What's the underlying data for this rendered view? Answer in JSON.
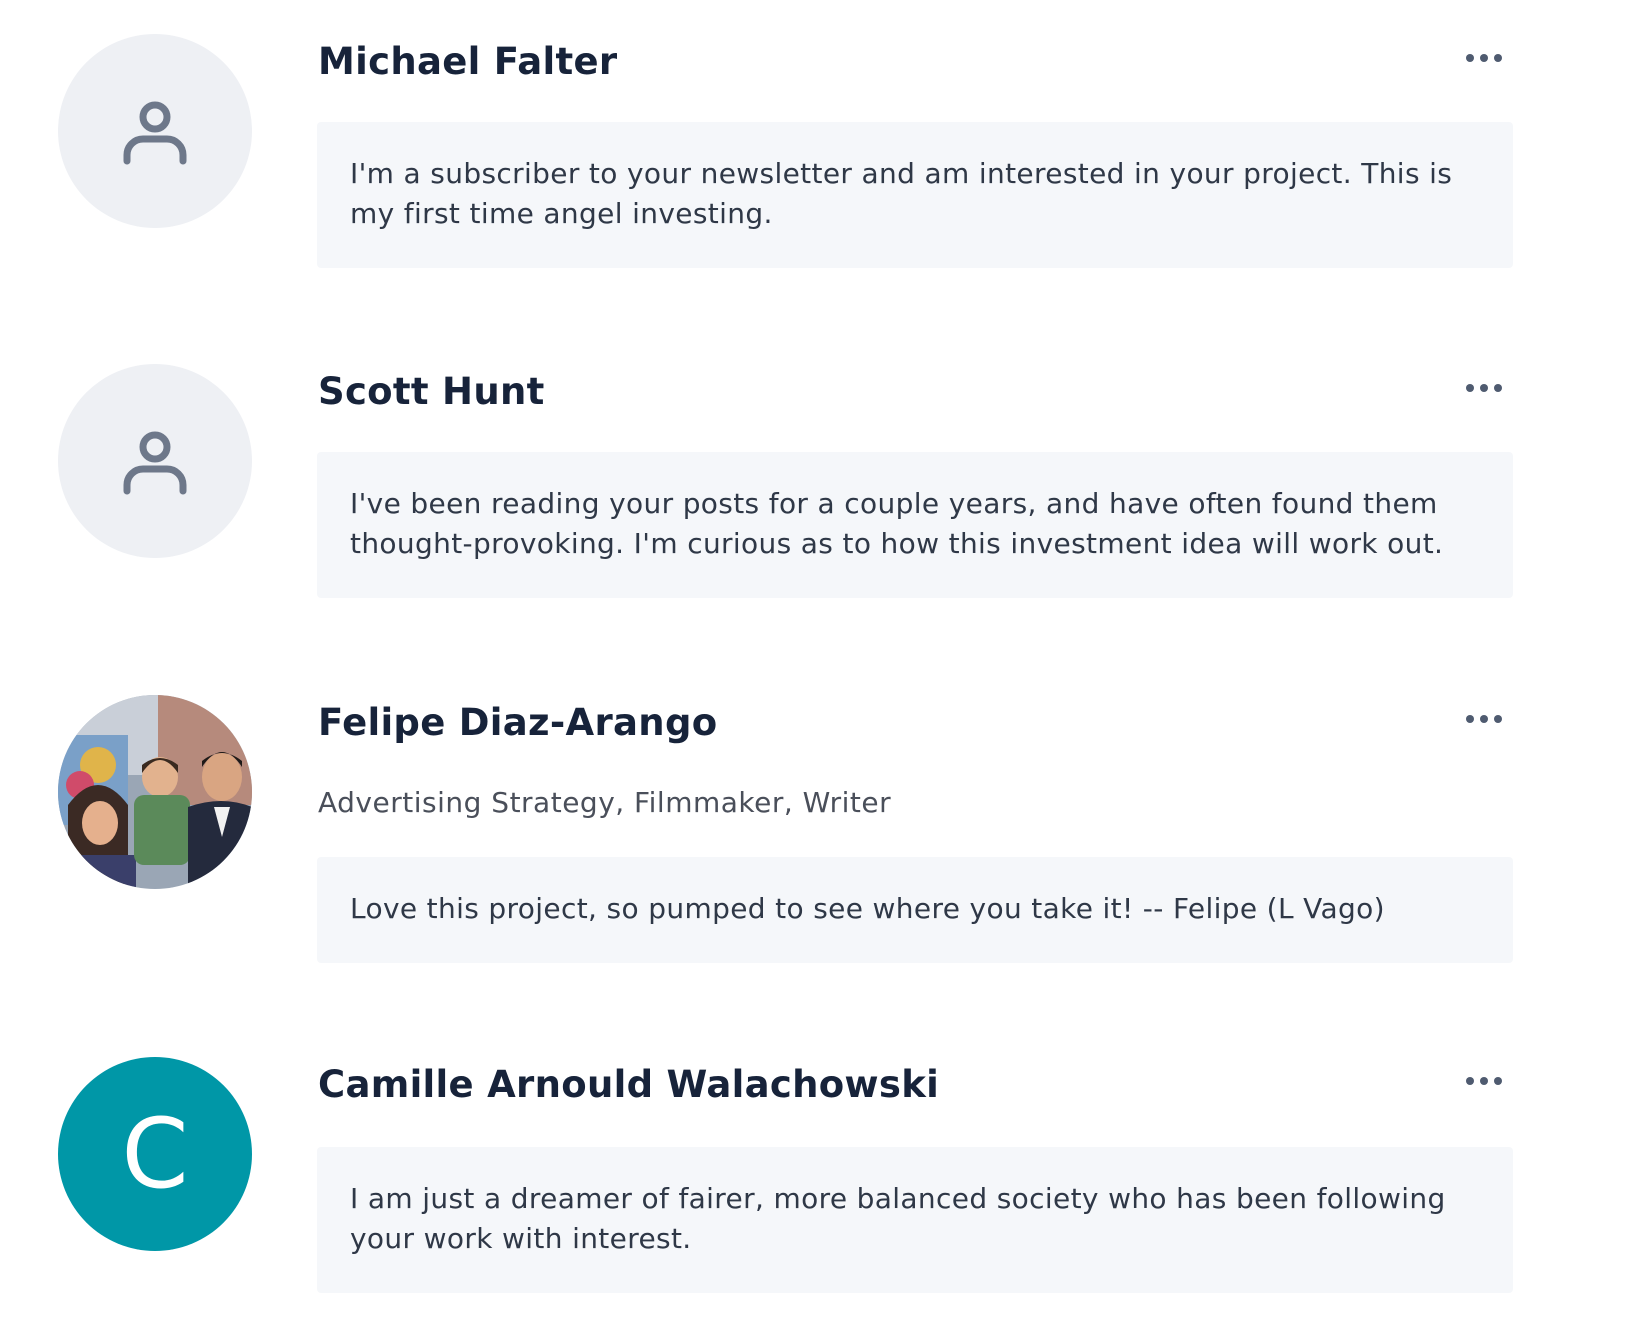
{
  "comments": [
    {
      "name": "Michael Falter",
      "avatar": "user-placeholder-icon",
      "subtitle": "",
      "message": "I'm a subscriber to your newsletter and am interested in your project. This is my first time angel investing."
    },
    {
      "name": "Scott Hunt",
      "avatar": "user-placeholder-icon",
      "subtitle": "",
      "message": "I've been reading your posts for a couple years, and have often found them thought-provoking. I'm curious as to how this investment idea will work out."
    },
    {
      "name": "Felipe Diaz-Arango",
      "avatar": "family-photo",
      "subtitle": "Advertising Strategy, Filmmaker, Writer",
      "message": "Love this project, so pumped to see where you take it! -- Felipe (L Vago)"
    },
    {
      "name": "Camille Arnould Walachowski",
      "avatar": "letter-avatar",
      "avatar_letter": "C",
      "avatar_color": "#0097a7",
      "subtitle": "",
      "message": "I am just a dreamer of fairer, more balanced society who has been following your work with interest."
    }
  ],
  "more_options_icon": "more-horizontal-icon"
}
